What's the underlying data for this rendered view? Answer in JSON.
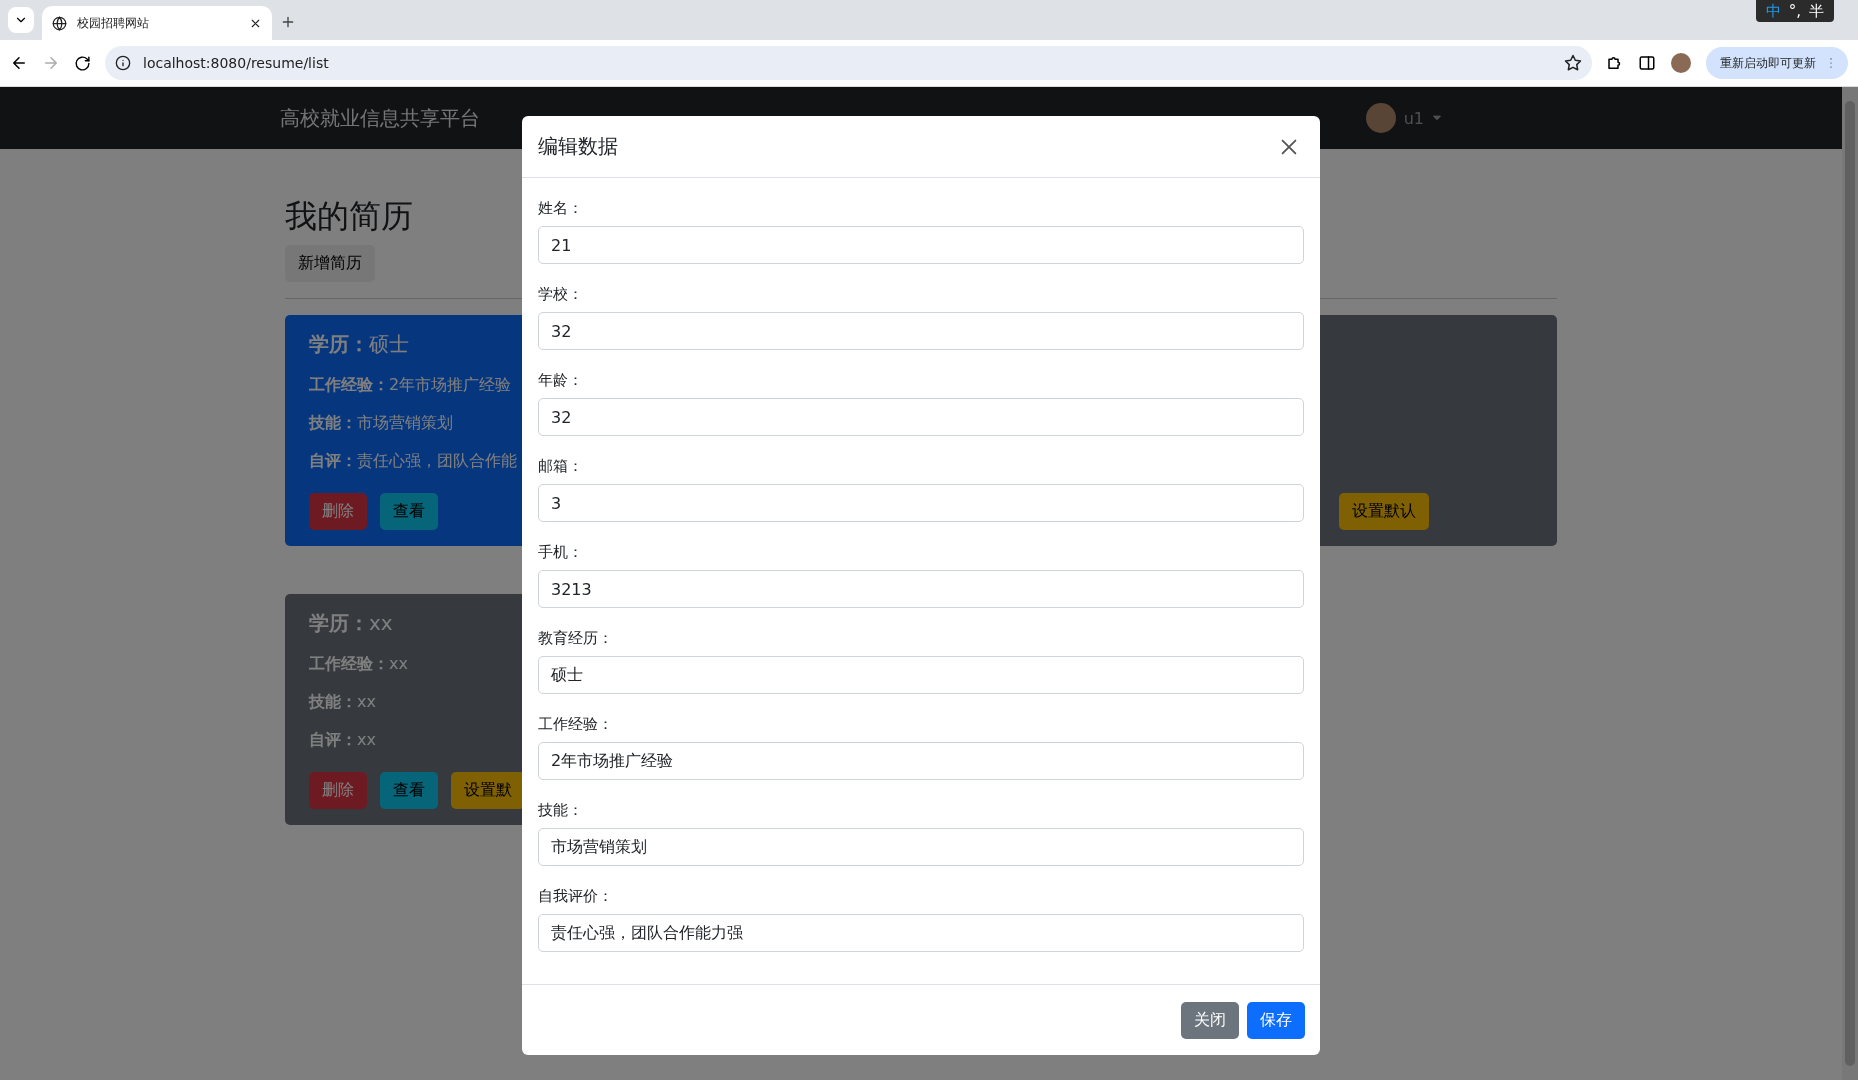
{
  "browser": {
    "tab_title": "校园招聘网站",
    "url": "localhost:8080/resume/list",
    "update_button": "重新启动即可更新",
    "ime": [
      "中",
      "°,",
      "半"
    ]
  },
  "navbar": {
    "brand": "高校就业信息共享平台",
    "user": "u1"
  },
  "page": {
    "title": "我的简历",
    "add_button": "新增简历",
    "cards": [
      {
        "kind": "primary",
        "fields": [
          {
            "label": "学历：",
            "value": "硕士"
          },
          {
            "label": "工作经验：",
            "value": "2年市场推广经验"
          },
          {
            "label": "技能：",
            "value": "市场营销策划"
          },
          {
            "label": "自评：",
            "value": "责任心强，团队合作能"
          }
        ],
        "buttons": [
          {
            "kind": "danger",
            "label": "删除"
          },
          {
            "kind": "info",
            "label": "查看"
          }
        ]
      },
      {
        "kind": "secondary",
        "buttons": [
          {
            "kind": "warning",
            "label": "设置默认"
          }
        ]
      },
      {
        "kind": "secondary",
        "fields": [
          {
            "label": "学历：",
            "value": "xx"
          },
          {
            "label": "工作经验：",
            "value": "xx"
          },
          {
            "label": "技能：",
            "value": "xx"
          },
          {
            "label": "自评：",
            "value": "xx"
          }
        ],
        "buttons": [
          {
            "kind": "danger",
            "label": "删除"
          },
          {
            "kind": "info",
            "label": "查看"
          },
          {
            "kind": "warning",
            "label": "设置默"
          }
        ]
      }
    ]
  },
  "modal": {
    "title": "编辑数据",
    "fields": [
      {
        "label": "姓名：",
        "value": "21"
      },
      {
        "label": "学校：",
        "value": "32"
      },
      {
        "label": "年龄：",
        "value": "32"
      },
      {
        "label": "邮箱：",
        "value": "3"
      },
      {
        "label": "手机：",
        "value": "3213"
      },
      {
        "label": "教育经历：",
        "value": "硕士"
      },
      {
        "label": "工作经验：",
        "value": "2年市场推广经验"
      },
      {
        "label": "技能：",
        "value": "市场营销策划"
      },
      {
        "label": "自我评价：",
        "value": "责任心强，团队合作能力强"
      }
    ],
    "buttons": [
      {
        "kind": "secondary",
        "label": "关闭"
      },
      {
        "kind": "primary",
        "label": "保存"
      }
    ]
  }
}
